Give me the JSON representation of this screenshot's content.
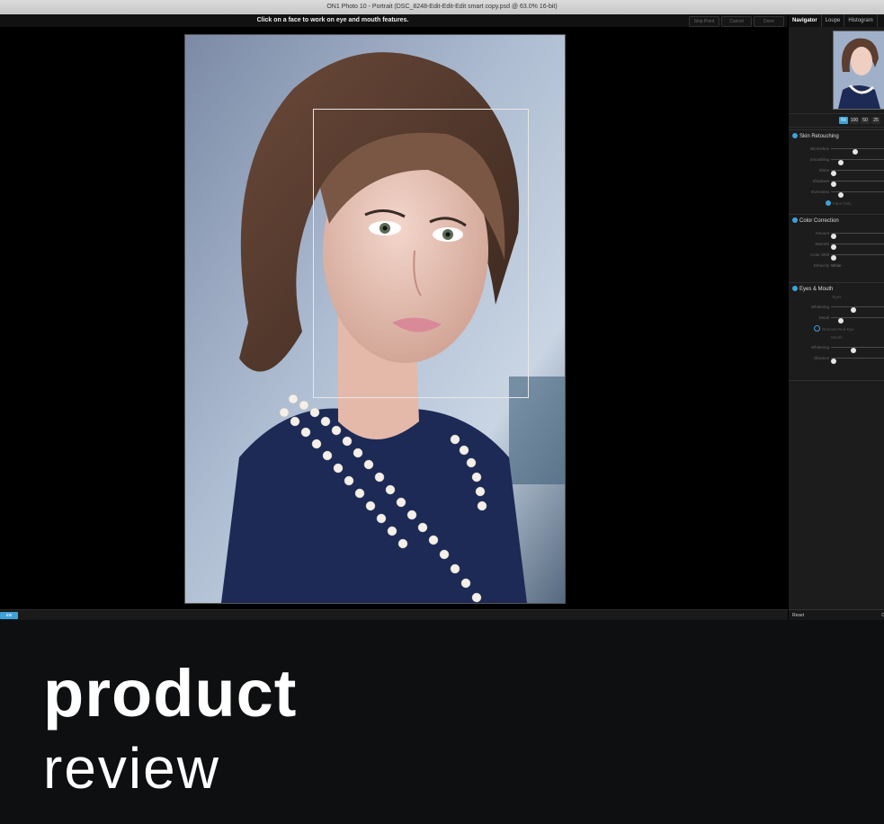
{
  "window": {
    "title": "ON1 Photo 10 - Portrait (DSC_8248-Edit-Edit-Edit smart copy.psd @ 63.0% 16-bit)"
  },
  "topbar": {
    "hint": "Click on a face to work on eye and mouth features.",
    "skip_label": "Skip Point",
    "cancel_label": "Cancel",
    "done_label": "Done"
  },
  "bottomstrip": {
    "zoom_label": "ew"
  },
  "panel": {
    "tabs": [
      "Navigator",
      "Loupe",
      "Histogram"
    ],
    "zoom": {
      "fit": "Fit",
      "z100": "100",
      "z50": "50",
      "z25": "25"
    },
    "skin": {
      "title": "Skin Retouching",
      "sliders": [
        {
          "label": "Blemishes",
          "value": 0.45
        },
        {
          "label": "Smoothing",
          "value": 0.15
        },
        {
          "label": "Shine",
          "value": 0.0
        },
        {
          "label": "Shadows",
          "value": 0.0
        },
        {
          "label": "Evenness",
          "value": 0.15
        }
      ],
      "checkbox": "Face Only"
    },
    "color": {
      "title": "Color Correction",
      "sliders": [
        {
          "label": "Amount",
          "value": 0.0
        },
        {
          "label": "Warmth",
          "value": 0.0
        },
        {
          "label": "Color Shift",
          "value": 0.0
        }
      ],
      "ethnicity_label": "Ethnicity",
      "ethnicity_value": "White"
    },
    "eyes": {
      "title": "Eyes & Mouth",
      "eyes_sub": "Eyes",
      "eye_sliders": [
        {
          "label": "Whitening",
          "value": 0.4
        },
        {
          "label": "Detail",
          "value": 0.15
        }
      ],
      "redeye": "Remove Red-Eye",
      "mouth_sub": "Mouth",
      "mouth_sliders": [
        {
          "label": "Whitening",
          "value": 0.4
        },
        {
          "label": "Vibrance",
          "value": 0.0
        }
      ]
    },
    "reset_label": "Reset",
    "right_label": "C"
  },
  "banner": {
    "line1": "product",
    "line2": "review"
  },
  "colors": {
    "accent": "#3ea1d8"
  }
}
